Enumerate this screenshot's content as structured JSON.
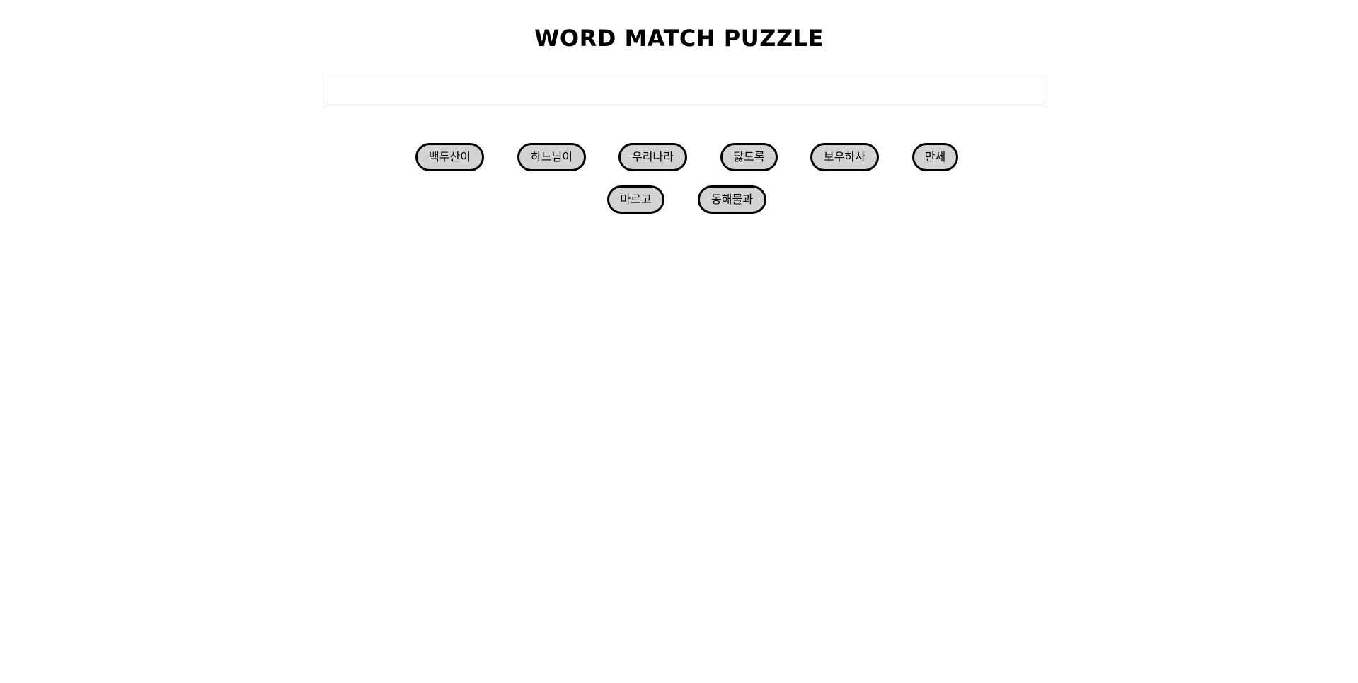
{
  "title": "WORD MATCH PUZZLE",
  "answer": "",
  "tiles": [
    {
      "label": "백두산이"
    },
    {
      "label": "하느님이"
    },
    {
      "label": "우리나라"
    },
    {
      "label": "닳도록"
    },
    {
      "label": "보우하사"
    },
    {
      "label": "만세"
    },
    {
      "label": "마르고"
    },
    {
      "label": "동해물과"
    }
  ],
  "colors": {
    "tile_fill": "#d3d3d3",
    "tile_border": "#000000",
    "background": "#ffffff"
  }
}
